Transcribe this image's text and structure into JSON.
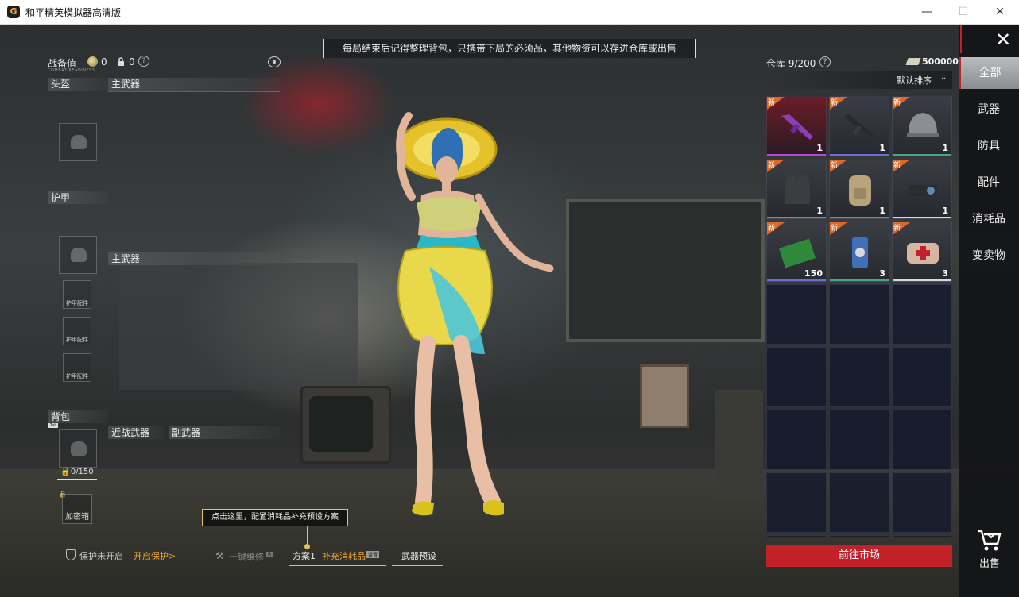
{
  "window": {
    "icon_letter": "G",
    "title": "和平精英模拟器高清版",
    "minimize": "—",
    "maximize": "☐",
    "close": "✕"
  },
  "tip_banner": "每局结束后记得整理背包，只携带下局的必须品，其他物资可以存进仓库或出售",
  "loadout": {
    "stat_label": "战备值",
    "stat_sub": "COMBAT READINESS",
    "coin_value": "0",
    "lock_value": "0",
    "help": "?",
    "sections": {
      "helmet": "头盔",
      "primary_1": "主武器",
      "armor": "护甲",
      "primary_2": "主武器",
      "backpack": "背包",
      "melee": "近战武器",
      "secondary": "副武器"
    },
    "armor_attachment_label": "护甲配件",
    "tab_badge": "Tab",
    "backpack_capacity": "0/150",
    "vault_label": "加密箱"
  },
  "callout": "点击这里，配置消耗品补充预设方案",
  "bottom_bar": {
    "protection_status": "保护未开启",
    "enable_protection": "开启保护>",
    "repair_all": "一键维修",
    "repair_key": "R",
    "plan": "方案1",
    "restock": "补充消耗品",
    "restock_key": "设置",
    "weapon_preset": "武器预设"
  },
  "warehouse": {
    "title": "仓库 9/200",
    "help": "?",
    "currency_amount": "500000",
    "sort_label": "默认排序",
    "market_button": "前往市场",
    "new_tag": "新",
    "items": [
      {
        "name": "紫色皮肤步枪",
        "count": "1",
        "rarity_color": "#b548d8",
        "icon": "rifle-purple-icon"
      },
      {
        "name": "突击步枪",
        "count": "1",
        "rarity_color": "#6f6ad8",
        "icon": "rifle-icon"
      },
      {
        "name": "三级头",
        "count": "1",
        "rarity_color": "#4aa58d",
        "icon": "helmet-icon"
      },
      {
        "name": "防弹衣",
        "count": "1",
        "rarity_color": "#4aa58d",
        "icon": "vest-icon"
      },
      {
        "name": "背包",
        "count": "1",
        "rarity_color": "#4aa58d",
        "icon": "backpack-icon"
      },
      {
        "name": "瞄准镜",
        "count": "1",
        "rarity_color": "#d8d8d8",
        "icon": "scope-icon"
      },
      {
        "name": "子弹",
        "count": "150",
        "rarity_color": "#6f6ad8",
        "icon": "ammo-box-icon"
      },
      {
        "name": "能量饮料",
        "count": "3",
        "rarity_color": "#4aa58d",
        "icon": "energy-drink-icon"
      },
      {
        "name": "急救包",
        "count": "3",
        "rarity_color": "#d8d8d8",
        "icon": "first-aid-icon"
      }
    ],
    "empty_slots_visible": 12
  },
  "categories": [
    {
      "label": "全部",
      "active": true
    },
    {
      "label": "武器",
      "active": false
    },
    {
      "label": "防具",
      "active": false
    },
    {
      "label": "配件",
      "active": false
    },
    {
      "label": "消耗品",
      "active": false
    },
    {
      "label": "变卖物",
      "active": false
    }
  ],
  "sell_label": "出售",
  "colors": {
    "accent_red": "#c2212a",
    "accent_orange": "#f0a631",
    "callout_border": "#e2c25a",
    "new_tag": "#d96a2b"
  }
}
